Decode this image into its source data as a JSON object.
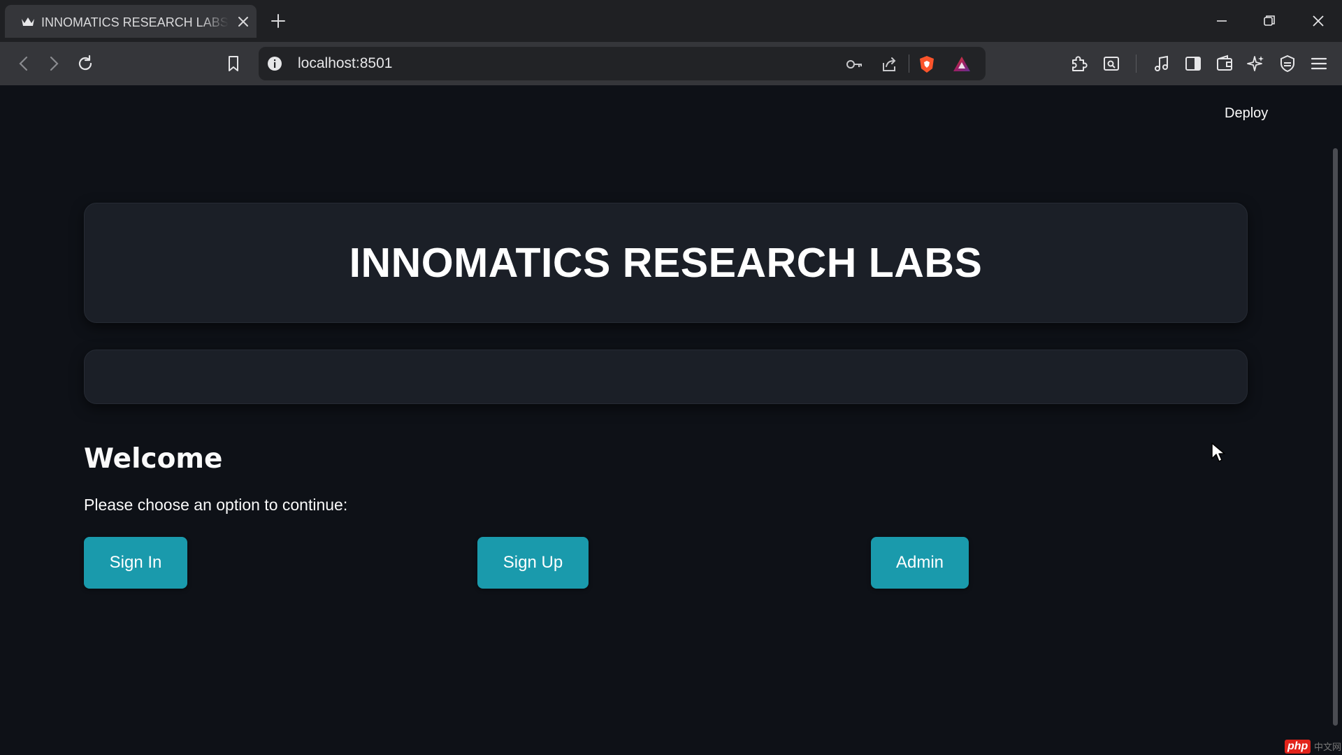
{
  "browser": {
    "tab_title": "INNOMATICS RESEARCH LABS - Streamlit",
    "url": "localhost:8501"
  },
  "icons": {
    "favicon": "crown-icon",
    "tab_close": "close-icon",
    "new_tab": "plus-icon",
    "minimize": "minimize-icon",
    "restore": "restore-icon",
    "close_window": "close-icon",
    "back": "chevron-left-icon",
    "forward": "chevron-right-icon",
    "reload": "reload-icon",
    "bookmark": "bookmark-icon",
    "site_info": "info-icon",
    "password_key": "key-icon",
    "share": "share-icon",
    "brave_shields": "lion-shield-icon",
    "brave_rewards": "triangle-icon",
    "extensions": "puzzle-icon",
    "screenshot": "screen-search-icon",
    "media": "music-note-icon",
    "sidebar": "sidebar-icon",
    "wallet": "wallet-icon",
    "leo_ai": "sparkle-icon",
    "vpn": "shield-check-icon",
    "menu": "hamburger-menu-icon"
  },
  "colors": {
    "page_background": "#0e1117",
    "card_background": "#1b1f27",
    "button_accent": "#1a9aac",
    "text": "#fafafa"
  },
  "header": {
    "deploy_label": "Deploy"
  },
  "main": {
    "banner_title": "INNOMATICS RESEARCH LABS",
    "subbar_text": "",
    "welcome_heading": "Welcome",
    "prompt_text": "Please choose an option to continue:",
    "buttons": {
      "sign_in": "Sign In",
      "sign_up": "Sign Up",
      "admin": "Admin"
    }
  },
  "watermark": {
    "logo_text": "php",
    "rest_text": "中文网"
  }
}
